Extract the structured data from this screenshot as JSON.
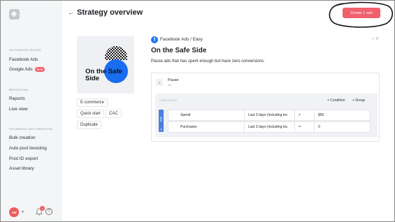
{
  "sidebar": {
    "sections": [
      {
        "title": "AUTOMATED RULES",
        "items": [
          {
            "label": "Facebook Ads"
          },
          {
            "label": "Google Ads",
            "badge": "beta"
          }
        ]
      },
      {
        "title": "REPORTING",
        "items": [
          {
            "label": "Reports"
          },
          {
            "label": "Live view"
          }
        ]
      },
      {
        "title": "FACEBOOK ADS CREATION",
        "items": [
          {
            "label": "Bulk creation"
          },
          {
            "label": "Auto post boosting"
          },
          {
            "label": "Post ID export"
          },
          {
            "label": "Asset library"
          }
        ]
      }
    ],
    "avatar_initials": "AM",
    "notification_count": "1",
    "help_glyph": "?"
  },
  "header": {
    "back_glyph": "←",
    "title": "Strategy overview",
    "create_button": "Create 1 rule"
  },
  "preview": {
    "text": "On the Safe Side",
    "tags": [
      "E-commerce",
      "Quick start",
      "CAC",
      "Duplicate"
    ]
  },
  "rule": {
    "platform_icon": "f",
    "meta": "Facebook Ads / Easy",
    "check": "✓ 6",
    "title": "On the Safe Side",
    "description": "Pause ads that has spent enough but have zero conversions.",
    "action": {
      "icon": "II",
      "label": "Pause",
      "sub": "Ad"
    },
    "conditions_title": "CONDITIONS",
    "add_condition": "+ Condition",
    "add_group": "+ Group",
    "and_label": "AND",
    "plus": "+",
    "rows": [
      {
        "metric": "Spend",
        "time": "Last 3 days (including toc",
        "operator": ">",
        "value": "$50"
      },
      {
        "metric": "Purchases",
        "time": "Last 3 days (including toc",
        "operator": "=",
        "value": "0"
      }
    ]
  },
  "colors": {
    "accent": "#f1606d",
    "facebook": "#1877f2",
    "and_bar": "#4a7fe0"
  }
}
